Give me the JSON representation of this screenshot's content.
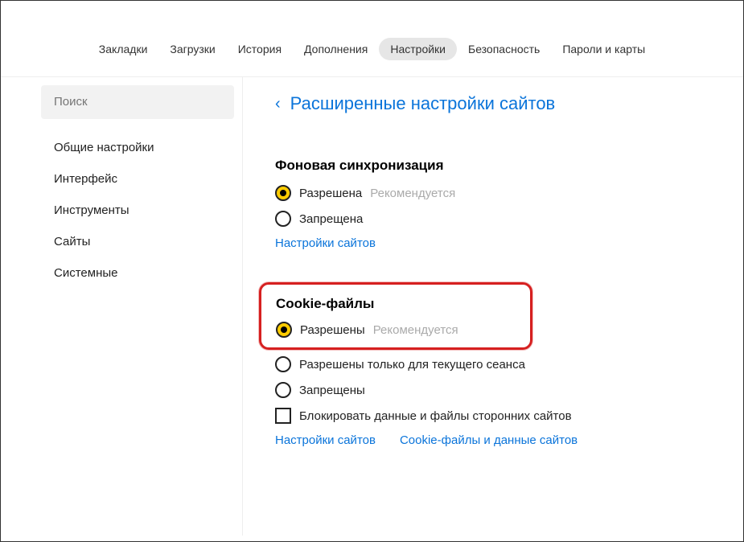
{
  "topNav": {
    "items": [
      {
        "label": "Закладки"
      },
      {
        "label": "Загрузки"
      },
      {
        "label": "История"
      },
      {
        "label": "Дополнения"
      },
      {
        "label": "Настройки"
      },
      {
        "label": "Безопасность"
      },
      {
        "label": "Пароли и карты"
      }
    ],
    "activeIndex": 4
  },
  "sidebar": {
    "searchPlaceholder": "Поиск",
    "items": [
      {
        "label": "Общие настройки"
      },
      {
        "label": "Интерфейс"
      },
      {
        "label": "Инструменты"
      },
      {
        "label": "Сайты"
      },
      {
        "label": "Системные"
      }
    ]
  },
  "breadcrumb": {
    "title": "Расширенные настройки сайтов"
  },
  "sections": {
    "bgSync": {
      "title": "Фоновая синхронизация",
      "options": [
        {
          "label": "Разрешена",
          "hint": "Рекомендуется",
          "checked": true
        },
        {
          "label": "Запрещена",
          "checked": false
        }
      ],
      "links": [
        "Настройки сайтов"
      ]
    },
    "cookies": {
      "title": "Cookie-файлы",
      "options": [
        {
          "label": "Разрешены",
          "hint": "Рекомендуется",
          "checked": true
        },
        {
          "label": "Разрешены только для текущего сеанса",
          "checked": false
        },
        {
          "label": "Запрещены",
          "checked": false
        }
      ],
      "checkbox": {
        "label": "Блокировать данные и файлы сторонних сайтов"
      },
      "links": [
        "Настройки сайтов",
        "Cookie-файлы и данные сайтов"
      ]
    }
  }
}
